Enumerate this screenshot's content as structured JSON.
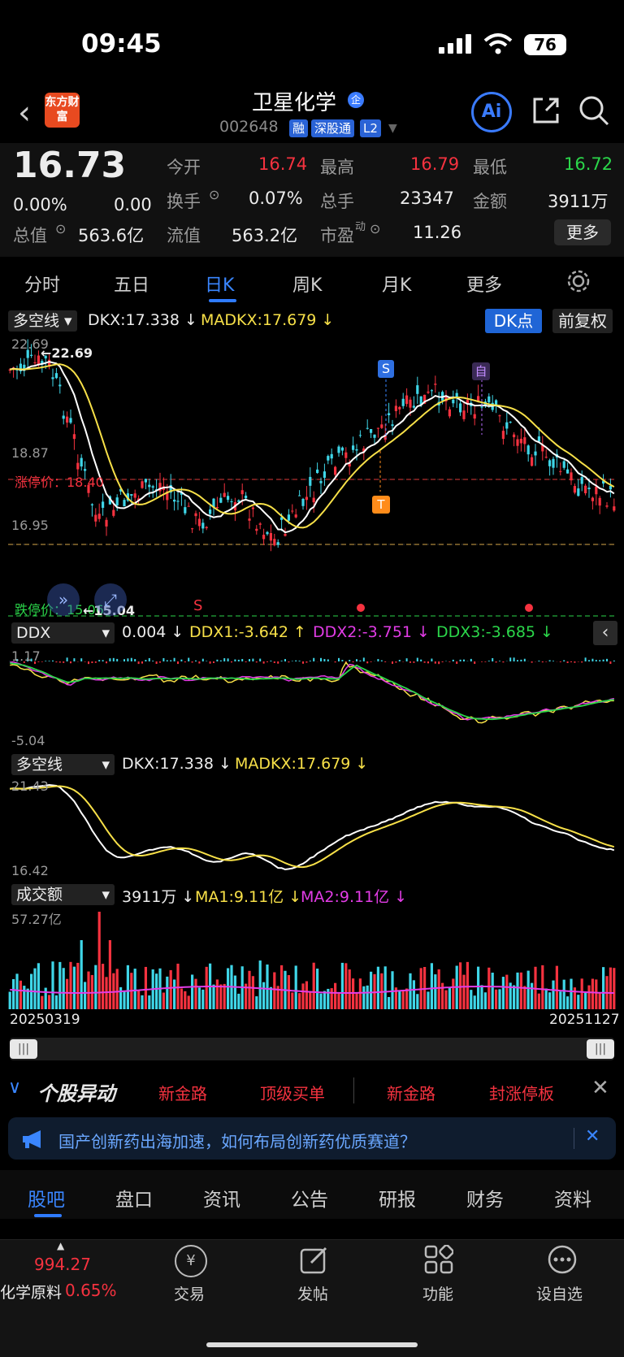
{
  "status_bar": {
    "time": "09:45",
    "battery": "76"
  },
  "header": {
    "logo_text": "东方财富",
    "stock_name": "卫星化学",
    "stock_code": "002648",
    "tags": [
      "融",
      "深股通",
      "L2"
    ],
    "ai_label": "Ai"
  },
  "quote": {
    "price": "16.73",
    "change_pct": "0.00%",
    "change": "0.00",
    "market_cap_label": "总值",
    "market_cap": "563.6亿",
    "float_cap_label": "流值",
    "float_cap": "563.2亿",
    "open_label": "今开",
    "open": "16.74",
    "high_label": "最高",
    "high": "16.79",
    "low_label": "最低",
    "low": "16.72",
    "turnover_label": "换手",
    "turnover": "0.07%",
    "volume_label": "总手",
    "volume": "23347",
    "amount_label": "金额",
    "amount": "3911万",
    "pe_label": "市盈",
    "pe_sup": "动",
    "pe": "11.26",
    "more_button": "更多"
  },
  "period_tabs": [
    "分时",
    "五日",
    "日K",
    "周K",
    "月K",
    "更多"
  ],
  "period_active": "日K",
  "main_indicator": {
    "selector": "多空线",
    "dkx": "DKX:17.338 ↓",
    "madkx": "MADKX:17.679 ↓",
    "dk_button": "DK点",
    "adjust_button": "前复权",
    "max_label": "22.69",
    "max_marker": "←22.69",
    "mid_label": "18.87",
    "low_label": "16.95",
    "limit_up_label": "涨停价：18.40",
    "limit_down_label": "跌停价：15.06",
    "min_marker": "←15.04",
    "signal_s": "S",
    "signal_zi": "自",
    "signal_t": "T"
  },
  "ddx": {
    "selector": "DDX",
    "value": "0.004 ↓",
    "ddx1": "DDX1:-3.642 ↑",
    "ddx2": "DDX2:-3.751 ↓",
    "ddx3": "DDX3:-3.685 ↓",
    "top": "1.17",
    "bottom": "-5.04"
  },
  "dkx_panel": {
    "selector": "多空线",
    "dkx": "DKX:17.338 ↓",
    "madkx": "MADKX:17.679 ↓",
    "top": "21.43",
    "bottom": "16.42"
  },
  "turnover_panel": {
    "selector": "成交额",
    "value": "3911万 ↓",
    "ma1": "MA1:9.11亿 ↓",
    "ma2": "MA2:9.11亿 ↓",
    "top": "57.27亿",
    "start_date": "20250319",
    "end_date": "20251127"
  },
  "stock_movement": {
    "title": "个股异动",
    "items": [
      "新金路",
      "顶级买单",
      "新金路",
      "封涨停板"
    ]
  },
  "news_banner": {
    "text": "国产创新药出海加速，如何布局创新药优质赛道？"
  },
  "bottom_tabs": [
    "股吧",
    "盘口",
    "资讯",
    "公告",
    "研报",
    "财务",
    "资料"
  ],
  "bottom_tab_active": "股吧",
  "nav": {
    "index_value": "994.27",
    "index_name": "化学原料",
    "index_pct": "0.65%",
    "items": [
      "交易",
      "发帖",
      "功能",
      "设自选"
    ]
  },
  "colors": {
    "up": "#f5323f",
    "down": "#2bd64a",
    "accent": "#2f7bff",
    "dkx": "#ffffff",
    "madkx": "#f7e048"
  }
}
